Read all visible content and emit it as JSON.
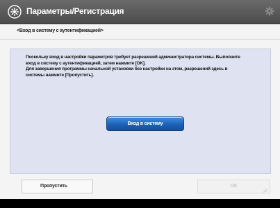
{
  "header": {
    "title": "Параметры/Регистрация",
    "settings_icon": "gear-icon",
    "status_icon": "gear-status-icon"
  },
  "breadcrumb": "<Вход в систему с аутентификацией>",
  "message": {
    "lines": [
      "Поскольку вход в настройки параметров требует разрешений администратора системы. Выполните",
      "вход в систему с аутентификацией, затем нажмите [OK].",
      "Для завершения программы начальной установки без настройки на этом, разрешений здесь в",
      "системы нажмите [Пропустить]."
    ]
  },
  "buttons": {
    "login": "Вход в систему",
    "skip": "Пропустить",
    "ok": "OK"
  },
  "colors": {
    "title_bar": "#5a5a5a",
    "panel": "#dfe3f1",
    "login_button": "#1a5fb4"
  }
}
